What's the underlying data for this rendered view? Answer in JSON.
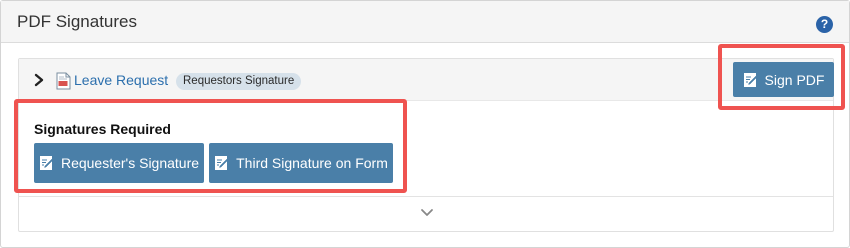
{
  "panel": {
    "title": "PDF Signatures",
    "help_icon": "?"
  },
  "document": {
    "link_label": "Leave Request",
    "badge_label": "Requestors Signature"
  },
  "actions": {
    "sign_pdf_label": "Sign PDF"
  },
  "signatures": {
    "title": "Signatures Required",
    "buttons": [
      {
        "label": "Requester's Signature"
      },
      {
        "label": "Third Signature on Form"
      }
    ]
  },
  "icons": {
    "help": "help-icon",
    "expand_row": "chevron-right-icon",
    "document": "pdf-document-icon",
    "sign": "edit-document-icon",
    "collapse_toggle": "chevron-down-icon"
  },
  "colors": {
    "button_bg": "#4a7fa8",
    "link": "#2c6fad",
    "help_icon": "#2b63a8",
    "badge_bg": "#d6e1ea",
    "highlight_border": "#ef5350"
  }
}
